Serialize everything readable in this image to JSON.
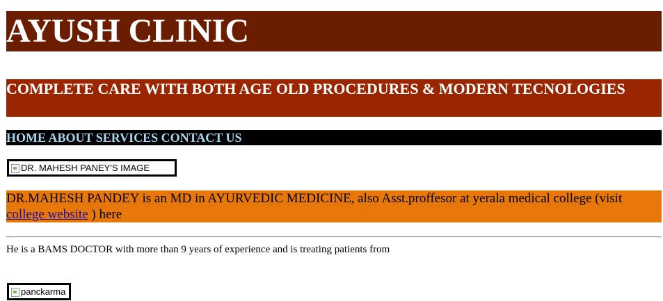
{
  "header": {
    "title": "AYUSH CLINIC",
    "tagline": "COMPLETE CARE WITH BOTH AGE OLD PROCEDURES & MODERN TECNOLOGIES"
  },
  "nav": {
    "items": [
      "HOME",
      "ABOUT",
      "SERVICES",
      "CONTACT US"
    ]
  },
  "doctor_image": {
    "alt": "DR. MAHESH PANEY'S IMAGE"
  },
  "about": {
    "text_before_link": "DR.MAHESH PANDEY is an MD in AYURVEDIC MEDICINE, also Asst.proffesor at yerala medical college (visit ",
    "link_text": "college website",
    "text_after_link": " ) here"
  },
  "experience": {
    "text": "He is a BAMS DOCTOR with more than 9 years of experience and is treating patients from"
  },
  "panchkarma_image": {
    "alt": "panckarma"
  },
  "colors": {
    "title_bg": "#6b1d00",
    "tagline_bg": "#992600",
    "nav_bg": "#000000",
    "nav_text": "#a6d8f0",
    "about_bg": "#e8770a",
    "link": "#1a0dab"
  }
}
